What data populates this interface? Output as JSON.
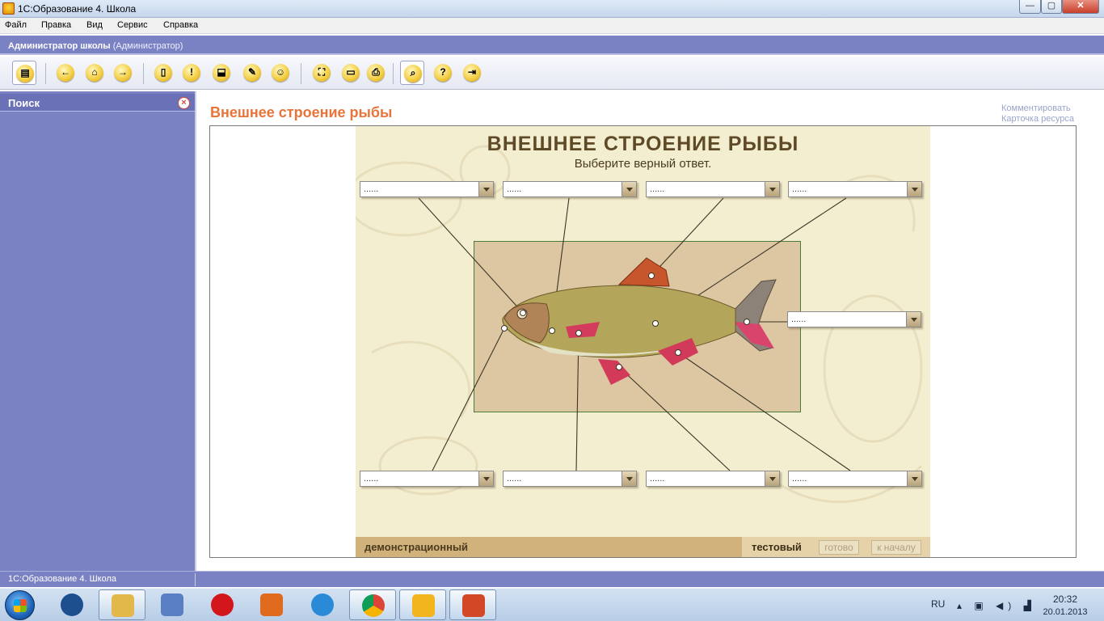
{
  "window": {
    "title": "1С:Образование 4. Школа",
    "min_glyph": "—",
    "max_glyph": "▢",
    "close_glyph": "✕"
  },
  "menu": [
    "Файл",
    "Правка",
    "Вид",
    "Сервис",
    "Справка"
  ],
  "user": {
    "name": "Администратор школы",
    "role": "(Администратор)"
  },
  "toolbar": {
    "buttons": [
      {
        "icon": "catalog-icon",
        "glyph": "▤"
      },
      {
        "icon": "back-arrow-icon",
        "glyph": "←"
      },
      {
        "icon": "home-icon",
        "glyph": "⌂"
      },
      {
        "icon": "forward-arrow-icon",
        "glyph": "→"
      },
      {
        "icon": "document-icon",
        "glyph": "▯"
      },
      {
        "icon": "note-icon",
        "glyph": "!"
      },
      {
        "icon": "basket-icon",
        "glyph": "⬓"
      },
      {
        "icon": "edit-icon",
        "glyph": "✎"
      },
      {
        "icon": "user-icon",
        "glyph": "☺"
      },
      {
        "icon": "fit-screen-icon",
        "glyph": "⛶"
      },
      {
        "icon": "monitor-icon",
        "glyph": "▭"
      },
      {
        "icon": "print-icon",
        "glyph": "⎙"
      },
      {
        "icon": "search-icon",
        "glyph": "⌕"
      },
      {
        "icon": "help-icon",
        "glyph": "?"
      },
      {
        "icon": "exit-icon",
        "glyph": "⇥"
      }
    ]
  },
  "sidebar": {
    "title": "Поиск",
    "close_glyph": "×"
  },
  "content": {
    "title": "Внешнее строение рыбы",
    "links": [
      "Комментировать",
      "Карточка ресурса"
    ]
  },
  "widget": {
    "title": "ВНЕШНЕЕ СТРОЕНИЕ РЫБЫ",
    "subtitle": "Выберите верный ответ.",
    "dropdown_value": "......",
    "dropdowns": [
      {
        "value": "......"
      },
      {
        "value": "......"
      },
      {
        "value": "......"
      },
      {
        "value": "......"
      },
      {
        "value": "......"
      },
      {
        "value": "......"
      },
      {
        "value": "......"
      },
      {
        "value": "......"
      },
      {
        "value": "......"
      }
    ],
    "mode_demo": "демонстрационный",
    "mode_test": "тестовый",
    "btn_done": "готово",
    "btn_start": "к началу"
  },
  "statusbar": {
    "text": "1С:Образование 4. Школа"
  },
  "taskbar": {
    "apps": [
      {
        "name": "media-player",
        "color": "#1d4f8f"
      },
      {
        "name": "file-explorer",
        "color": "#e3b84a"
      },
      {
        "name": "tools",
        "color": "#5a7ec4"
      },
      {
        "name": "opera",
        "color": "#d3161c"
      },
      {
        "name": "office-setup",
        "color": "#e06a1e"
      },
      {
        "name": "internet-explorer",
        "color": "#2a8ad8"
      },
      {
        "name": "chrome",
        "color": "#3a9b45"
      },
      {
        "name": "1c-education",
        "color": "#f2b51d"
      },
      {
        "name": "powerpoint",
        "color": "#d24726"
      }
    ],
    "lang": "RU",
    "tray_glyphs": "▴ ▣ ◀) ▟",
    "time": "20:32",
    "date": "20.01.2013"
  }
}
